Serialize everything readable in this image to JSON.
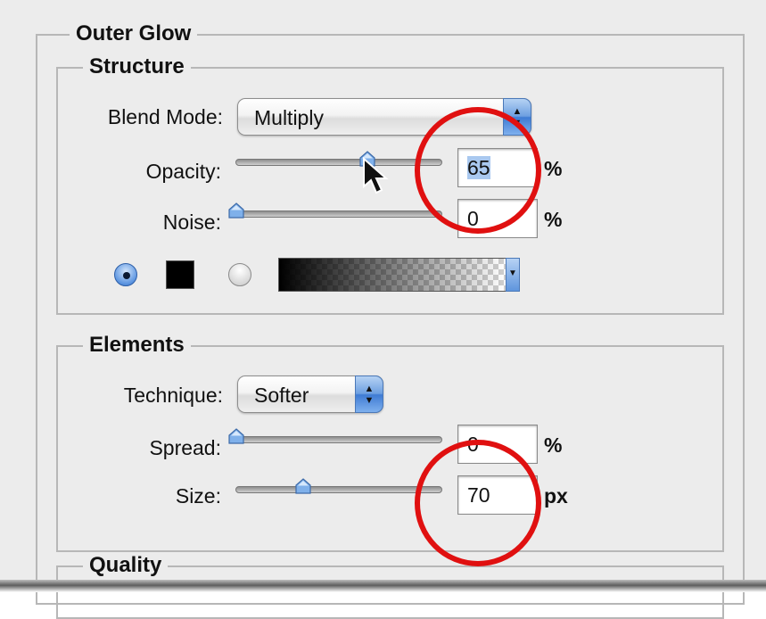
{
  "outer_glow": {
    "title": "Outer Glow",
    "structure": {
      "title": "Structure",
      "blend_mode": {
        "label": "Blend Mode:",
        "value": "Multiply"
      },
      "opacity": {
        "label": "Opacity:",
        "value": "65",
        "unit": "%",
        "slider_fraction": 0.65
      },
      "noise": {
        "label": "Noise:",
        "value": "0",
        "unit": "%",
        "slider_fraction": 0.0
      },
      "color_mode": {
        "selected": "solid-color",
        "swatch_color": "#000000"
      }
    },
    "elements": {
      "title": "Elements",
      "technique": {
        "label": "Technique:",
        "value": "Softer"
      },
      "spread": {
        "label": "Spread:",
        "value": "0",
        "unit": "%",
        "slider_fraction": 0.0
      },
      "size": {
        "label": "Size:",
        "value": "70",
        "unit": "px",
        "slider_fraction": 0.28
      }
    },
    "quality": {
      "title": "Quality"
    }
  },
  "annotations": {
    "circle_color": "#e01010"
  },
  "icons": [
    "popup-arrows-icon",
    "slider-thumb-icon",
    "mouse-pointer-icon",
    "gradient-dropdown-icon"
  ]
}
